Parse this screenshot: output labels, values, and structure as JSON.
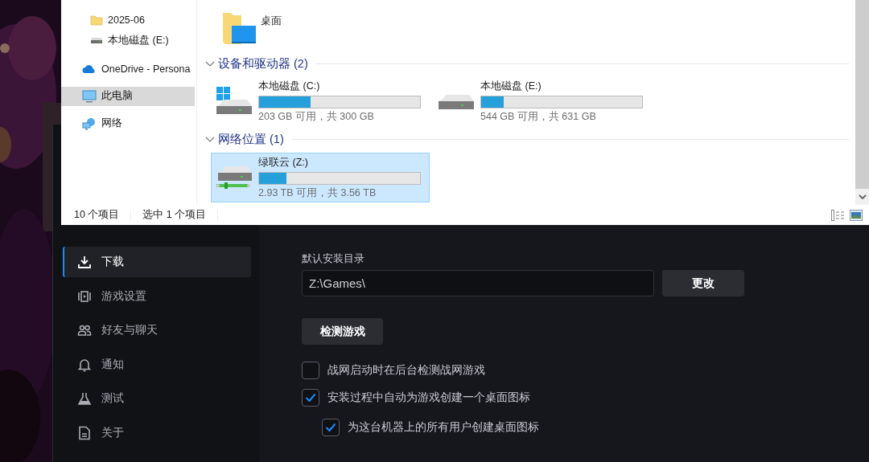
{
  "explorer": {
    "quick_access": [
      {
        "label": "2025-06",
        "pinned": false,
        "selected": false
      },
      {
        "label": "本地磁盘 (E:)",
        "pinned": false,
        "selected": false
      }
    ],
    "roots": [
      {
        "label": "OneDrive - Persona",
        "selected": false
      },
      {
        "label": "此电脑",
        "selected": true
      },
      {
        "label": "网络",
        "selected": false
      }
    ],
    "folders": [
      {
        "label": "桌面"
      }
    ],
    "groups": [
      {
        "title": "设备和驱动器 (2)",
        "expanded": true,
        "drives": [
          {
            "name": "本地磁盘 (C:)",
            "kind": "system",
            "level": 0.32,
            "free": "203 GB 可用，共 300 GB",
            "selected": false
          },
          {
            "name": "本地磁盘 (E:)",
            "kind": "local",
            "level": 0.14,
            "free": "544 GB 可用，共 631 GB",
            "selected": false
          }
        ]
      },
      {
        "title": "网络位置 (1)",
        "expanded": true,
        "drives": [
          {
            "name": "绿联云 (Z:)",
            "kind": "network",
            "level": 0.17,
            "free": "2.93 TB 可用，共 3.56 TB",
            "selected": true
          }
        ]
      }
    ],
    "status_bar": {
      "count": "10 个项目",
      "selection": "选中 1 个项目"
    }
  },
  "app": {
    "sidebar": [
      {
        "label": "下载",
        "selected": true
      },
      {
        "label": "游戏设置",
        "selected": false
      },
      {
        "label": "好友与聊天",
        "selected": false
      },
      {
        "label": "通知",
        "selected": false
      },
      {
        "label": "测试",
        "selected": false
      },
      {
        "label": "关于",
        "selected": false
      }
    ],
    "install_dir": {
      "label": "默认安装目录",
      "value": "Z:\\Games\\"
    },
    "change_button": "更改",
    "scan_button": "检测游戏",
    "options": [
      {
        "label": "战网启动时在后台检测战网游戏",
        "checked": false
      },
      {
        "label": "安装过程中自动为游戏创建一个桌面图标",
        "checked": true,
        "children": [
          {
            "label": "为这台机器上的所有用户创建桌面图标",
            "checked": true
          }
        ]
      }
    ]
  }
}
